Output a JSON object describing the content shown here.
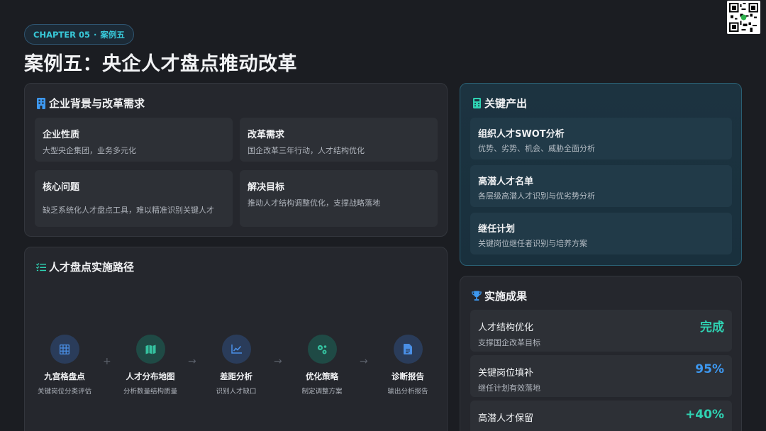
{
  "header": {
    "chapter": "CHAPTER 05",
    "chapter_sep": "·",
    "chapter_case": "案例五",
    "title": "案例五：央企人才盘点推动改革"
  },
  "background_panel": {
    "title": "企业背景与改革需求",
    "icon": "building-icon",
    "cards": [
      {
        "title": "企业性质",
        "desc": "大型央企集团，业务多元化"
      },
      {
        "title": "改革需求",
        "desc": "国企改革三年行动，人才结构优化"
      },
      {
        "title": "核心问题",
        "desc": "缺乏系统化人才盘点工具，难以精准识别关键人才"
      },
      {
        "title": "解决目标",
        "desc": "推动人才结构调整优化，支撑战略落地"
      }
    ]
  },
  "path_panel": {
    "title": "人才盘点实施路径",
    "icon": "checklist-icon",
    "steps": [
      {
        "name": "九宫格盘点",
        "desc": "关键岗位分类评估",
        "icon": "grid-icon",
        "color": "#4a8fe6"
      },
      {
        "name": "人才分布地图",
        "desc": "分析数量结构质量",
        "icon": "map-icon",
        "color": "#35c2a0"
      },
      {
        "name": "差距分析",
        "desc": "识别人才缺口",
        "icon": "chart-line-icon",
        "color": "#4a8fe6"
      },
      {
        "name": "优化策略",
        "desc": "制定调整方案",
        "icon": "gears-icon",
        "color": "#35c2a0"
      },
      {
        "name": "诊断报告",
        "desc": "输出分析报告",
        "icon": "document-icon",
        "color": "#4a8fe6"
      }
    ],
    "arrow": "→",
    "plus": "+"
  },
  "key_output_panel": {
    "title": "关键产出",
    "icon": "calculator-icon",
    "items": [
      {
        "title": "组织人才SWOT分析",
        "desc": "优势、劣势、机会、威胁全面分析"
      },
      {
        "title": "高潜人才名单",
        "desc": "各层级高潜人才识别与优劣势分析"
      },
      {
        "title": "继任计划",
        "desc": "关键岗位继任者识别与培养方案"
      }
    ]
  },
  "results_panel": {
    "title": "实施成果",
    "icon": "trophy-icon",
    "items": [
      {
        "label": "人才结构优化",
        "sub": "支撑国企改革目标",
        "value": "完成",
        "color": "#2fd3b3"
      },
      {
        "label": "关键岗位填补",
        "sub": "继任计划有效落地",
        "value": "95%",
        "color": "#3d98f0"
      },
      {
        "label": "高潜人才保留",
        "sub": "",
        "value": "+40%",
        "color": "#2fd3b3"
      }
    ]
  },
  "colors": {
    "accent_teal": "#2fd3b3",
    "accent_blue": "#3d98f0",
    "background": "#1b1d22"
  }
}
